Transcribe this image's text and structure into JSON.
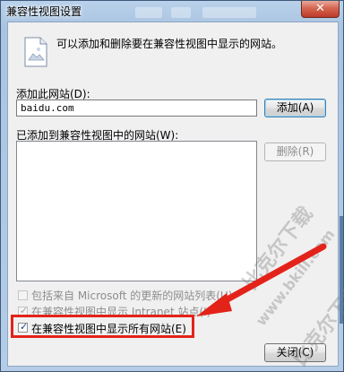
{
  "window": {
    "title": "兼容性视图设置",
    "close_label": "✕"
  },
  "intro": {
    "text": "可以添加和删除要在兼容性视图中显示的网站。"
  },
  "add_site": {
    "label": "添加此网站(D):",
    "value": "baidu.com",
    "add_button": "添加(A)"
  },
  "added_list": {
    "label": "已添加到兼容性视图中的网站(W):",
    "remove_button": "删除(R)"
  },
  "options": [
    {
      "label": "包括来自 Microsoft 的更新的网站列表(U)",
      "checked": false,
      "enabled": false
    },
    {
      "label": "在兼容性视图中显示 Intranet 站点(I)",
      "checked": true,
      "enabled": false
    },
    {
      "label": "在兼容性视图中显示所有网站(E)",
      "checked": true,
      "enabled": true
    }
  ],
  "footer": {
    "close_button": "关闭(C)"
  },
  "watermark": {
    "text_1": "比克尔下载",
    "text_2": "www.bkill.com",
    "text_3": "比克尔下载"
  },
  "colors": {
    "highlight": "#e3231a",
    "accent": "#3c7fb1"
  }
}
